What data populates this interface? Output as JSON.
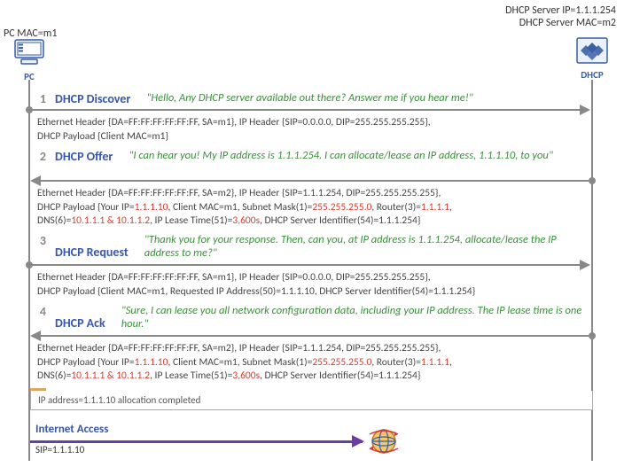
{
  "endpoints": {
    "pc_label": "PC MAC=m1",
    "pc_node": "PC",
    "dhcp_label_ip": "DHCP Server IP=1.1.1.254",
    "dhcp_label_mac": "DHCP Server MAC=m2",
    "dhcp_node": "DHCP"
  },
  "messages": [
    {
      "num": "1",
      "title": "DHCP Discover",
      "quote": "\"Hello, Any DHCP server available out there? Answer me if you hear me!\"",
      "line1_a": "Ethernet Header {DA=FF:FF:FF:FF:FF:FF, SA=m1}, IP Header {SIP=0.0.0.0, DIP=255.255.255.255},",
      "line2_a": "DHCP Payload {Client MAC=m1}"
    },
    {
      "num": "2",
      "title": "DHCP Offer",
      "quote": "\"I can hear you! My IP address is 1.1.1.254. I can allocate/lease an IP address, 1.1.1.10, to you\"",
      "line1_a": "Ethernet Header {DA=FF:FF:FF:FF:FF:FF, SA=m2}, IP Header {SIP=1.1.1.254, DIP=255.255.255.255},",
      "line2_a": "DHCP Payload {Your IP=",
      "line2_b": "1.1.1.10",
      "line2_c": ", Client MAC=m1, Subnet Mask(1)=",
      "line2_d": "255.255.255.0",
      "line2_e": ", Router(3)=",
      "line2_f": "1.1.1.1",
      "line2_g": ",",
      "line3_a": "DNS(6)=",
      "line3_b": "10.1.1.1 & 10.1.1.2",
      "line3_c": ", IP Lease Time(51)=",
      "line3_d": "3,600s",
      "line3_e": ", DHCP Server Identifier(54)=1.1.1.254}"
    },
    {
      "num": "3",
      "title": "DHCP Request",
      "quote": "\"Thank you for your response. Then, can you, at IP address is 1.1.1.254, allocate/lease the IP address to me?\"",
      "line1_a": "Ethernet Header {DA=FF:FF:FF:FF:FF:FF, SA=m1}, IP Header {SIP=0.0.0.0, DIP=255.255.255.255},",
      "line2_a": "DHCP Payload {Client MAC=m1, Requested IP Address(50)=1.1.1.10, DHCP Server Identifier(54)=1.1.1.254}"
    },
    {
      "num": "4",
      "title": "DHCP Ack",
      "quote": "\"Sure, I can lease you all network configuration data, including your IP address. The IP lease time is one hour.\"",
      "line1_a": "Ethernet Header {DA=FF:FF:FF:FF:FF:FF, SA=m2}, IP Header {SIP=1.1.1.254, DIP=255.255.255.255},",
      "line2_a": "DHCP Payload {Your IP=",
      "line2_b": "1.1.1.10",
      "line2_c": ", Client MAC=m1, Subnet Mask(1)=",
      "line2_d": "255.255.255.0",
      "line2_e": ", Router(3)=",
      "line2_f": "1.1.1.1",
      "line2_g": ",",
      "line3_a": "DNS(6)=",
      "line3_b": "10.1.1.1 & 10.1.1.2",
      "line3_c": ", IP Lease Time(51)=",
      "line3_d": "3,600s",
      "line3_e": ", DHCP Server Identifier(54)=1.1.1.254}"
    }
  ],
  "alloc": "IP address=1.1.1.10 allocation completed",
  "internet": {
    "title": "Internet Access",
    "sip": "SIP=1.1.1.10"
  }
}
